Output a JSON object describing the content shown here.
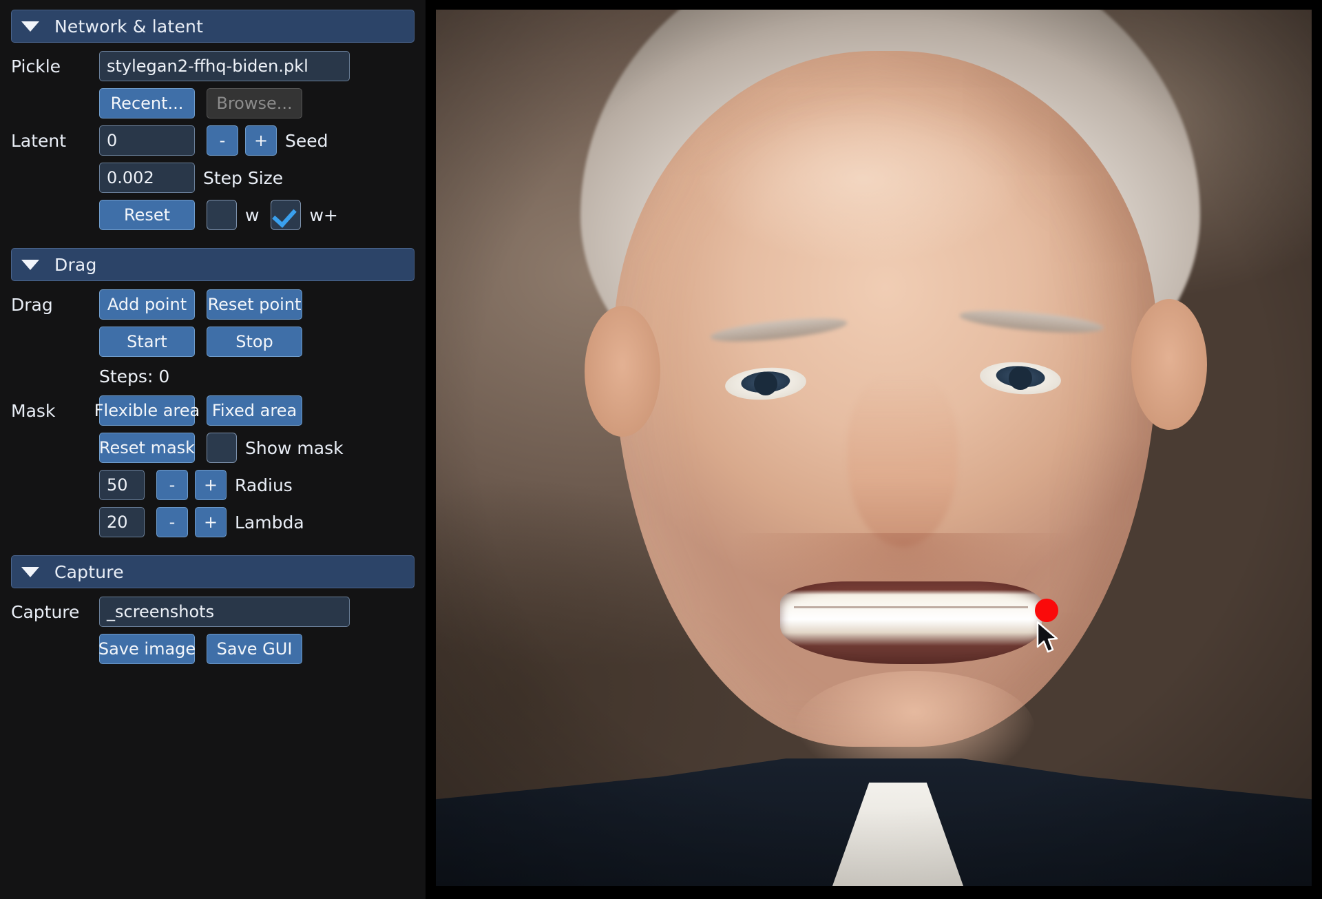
{
  "panel": {
    "sections": [
      {
        "id": "network_latent",
        "title": "Network & latent",
        "collapse_icon": "triangle-down-icon"
      },
      {
        "id": "drag",
        "title": "Drag",
        "collapse_icon": "triangle-down-icon"
      },
      {
        "id": "capture",
        "title": "Capture",
        "collapse_icon": "triangle-down-icon"
      }
    ],
    "network": {
      "pickle_label": "Pickle",
      "pickle_value": "stylegan2-ffhq-biden.pkl",
      "recent_button": "Recent...",
      "browse_button": "Browse...",
      "latent_label": "Latent",
      "seed_value": "0",
      "seed_minus": "-",
      "seed_plus": "+",
      "seed_label": "Seed",
      "step_size_value": "0.002",
      "step_size_label": "Step Size",
      "reset_button": "Reset",
      "w_label": "w",
      "w_checked": false,
      "wplus_label": "w+",
      "wplus_checked": true
    },
    "drag": {
      "drag_label": "Drag",
      "add_point_button": "Add point",
      "reset_point_button": "Reset point",
      "start_button": "Start",
      "stop_button": "Stop",
      "steps_text": "Steps: 0",
      "mask_label": "Mask",
      "flexible_area_button": "Flexible area",
      "fixed_area_button": "Fixed area",
      "reset_mask_button": "Reset mask",
      "show_mask_label": "Show mask",
      "show_mask_checked": false,
      "radius_value": "50",
      "radius_minus": "-",
      "radius_plus": "+",
      "radius_label": "Radius",
      "lambda_value": "20",
      "lambda_minus": "-",
      "lambda_plus": "+",
      "lambda_label": "Lambda"
    },
    "capture": {
      "capture_label": "Capture",
      "capture_path": "_screenshots",
      "save_image_button": "Save image",
      "save_gui_button": "Save GUI"
    }
  },
  "viewport": {
    "image_description": "Generated portrait of a smiling man with white hair in a dark suit",
    "drag_point_color": "#fa0a0a",
    "cursor_icon": "arrow-cursor-icon"
  },
  "colors": {
    "panel_bg": "#131314",
    "section_header_bg": "#2c4468",
    "button_blue": "#3f6fa8",
    "button_disabled": "#343434",
    "field_bg": "#293749",
    "text": "#e9eef6",
    "check_accent": "#3aa0ee"
  }
}
